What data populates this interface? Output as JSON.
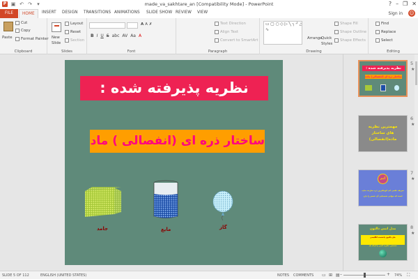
{
  "window": {
    "title": "made_va_sakhtare_an [Compatibility Mode] - PowerPoint",
    "app_logo": "P",
    "controls": {
      "help": "?",
      "minimize": "–",
      "restore": "❐",
      "close": "✕"
    }
  },
  "qat": {
    "save": "▣",
    "undo": "↶",
    "redo": "↷",
    "customize": "▾"
  },
  "tabs": [
    {
      "label": "FILE"
    },
    {
      "label": "HOME"
    },
    {
      "label": "INSERT"
    },
    {
      "label": "DESIGN"
    },
    {
      "label": "TRANSITIONS"
    },
    {
      "label": "ANIMATIONS"
    },
    {
      "label": "SLIDE SHOW"
    },
    {
      "label": "REVIEW"
    },
    {
      "label": "VIEW"
    }
  ],
  "account": {
    "signin": "Sign in",
    "feedback_icon": "☺"
  },
  "ribbon": {
    "clipboard": {
      "paste": "Paste",
      "cut": "Cut",
      "copy": "Copy",
      "format_painter": "Format Painter",
      "label": "Clipboard"
    },
    "slides": {
      "new_slide": "New",
      "new_slide_2": "Slide",
      "layout": "Layout",
      "reset": "Reset",
      "section": "Section",
      "label": "Slides"
    },
    "font": {
      "label": "Font",
      "grow": "A",
      "shrink": "A",
      "clear": "✗",
      "bold": "B",
      "italic": "I",
      "underline": "U",
      "strike": "S",
      "shadow": "abc",
      "spacing": "AV",
      "case": "Aa",
      "color": "A"
    },
    "paragraph": {
      "text_direction": "Text Direction",
      "align_text": "Align Text",
      "convert": "Convert to SmartArt",
      "label": "Paragraph"
    },
    "drawing": {
      "shapes_preview": "▭▢○◇▷╲┐┘△⬠⬡☆{}∿",
      "arrange": "Arrange",
      "quick_styles": "Quick",
      "quick_styles_2": "Styles",
      "shape_fill": "Shape Fill",
      "shape_outline": "Shape Outline",
      "shape_effects": "Shape Effects",
      "label": "Drawing"
    },
    "editing": {
      "find": "Find",
      "replace": "Replace",
      "select": "Select",
      "label": "Editing"
    }
  },
  "slide": {
    "title": "نظریه پذیرفته شده :",
    "subtitle": "ساختار ذره ای (انفصالی ) ماده",
    "labels": {
      "solid": "جامد",
      "liquid": "مایع",
      "gas": "گاز"
    },
    "colors": {
      "bg": "#5f8a7a",
      "title_bg": "#ee2253",
      "subtitle_bg": "#ff9e00",
      "subtitle_text": "#ff0080"
    }
  },
  "thumbnails": [
    {
      "num": "5",
      "star": "★",
      "title": "نظریه پذیرفته شده :",
      "sub": "ساختار ذره ای (انفصالی) ماده"
    },
    {
      "num": "6",
      "star": "★",
      "line1": "مهمترین نظریه",
      "line2": "های ساختار",
      "line3": "ماده(انفصالی)"
    },
    {
      "num": "7",
      "star": "★",
      "badge": "اتم",
      "text1": "تعریف علمی اتم کوچکترین ذره سازنده ماده",
      "text2": "است که خواص شیمیایی آن عنصر را دارد"
    },
    {
      "num": "8",
      "star": "★",
      "title": "مدل اتمی دالتون",
      "text1": "جان دالتون دانشمند انگلیسی",
      "text2": "نخستین نظریه اتمی را ارائه داد"
    }
  ],
  "status": {
    "slide": "SLIDE 5 OF 112",
    "language": "ENGLISH (UNITED STATES)",
    "notes": "NOTES",
    "comments": "COMMENTS",
    "zoom": "74%",
    "minus": "–",
    "plus": "+"
  }
}
